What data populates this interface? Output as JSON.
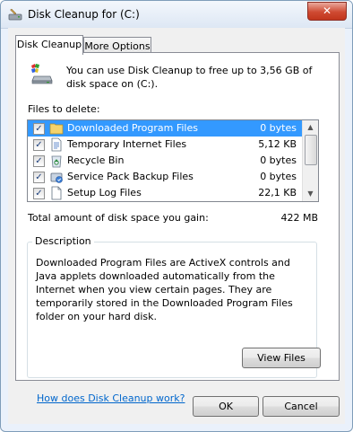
{
  "window": {
    "title": "Disk Cleanup for  (C:)",
    "close_label": "✕"
  },
  "tabs": [
    {
      "label": "Disk Cleanup"
    },
    {
      "label": "More Options"
    }
  ],
  "intro_text": "You can use Disk Cleanup to free up to 3,56 GB of disk space on  (C:).",
  "files_label": "Files to delete:",
  "files": [
    {
      "name": "Downloaded Program Files",
      "size": "0 bytes",
      "checked": true,
      "selected": true,
      "icon": "folder-icon"
    },
    {
      "name": "Temporary Internet Files",
      "size": "5,12 KB",
      "checked": true,
      "selected": false,
      "icon": "document-icon"
    },
    {
      "name": "Recycle Bin",
      "size": "0 bytes",
      "checked": true,
      "selected": false,
      "icon": "recycle-bin-icon"
    },
    {
      "name": "Service Pack Backup Files",
      "size": "0 bytes",
      "checked": true,
      "selected": false,
      "icon": "backup-icon"
    },
    {
      "name": "Setup Log Files",
      "size": "22,1 KB",
      "checked": true,
      "selected": false,
      "icon": "log-file-icon"
    }
  ],
  "total_label": "Total amount of disk space you gain:",
  "total_value": "422 MB",
  "description": {
    "legend": "Description",
    "text": "Downloaded Program Files are ActiveX controls and Java applets downloaded automatically from the Internet when you view certain pages. They are temporarily stored in the Downloaded Program Files folder on your hard disk.",
    "button": "View Files"
  },
  "help_link": "How does Disk Cleanup work?",
  "buttons": {
    "ok": "OK",
    "cancel": "Cancel"
  },
  "colors": {
    "selection": "#3399ff",
    "link": "#0066cc",
    "close": "#c1351c"
  }
}
